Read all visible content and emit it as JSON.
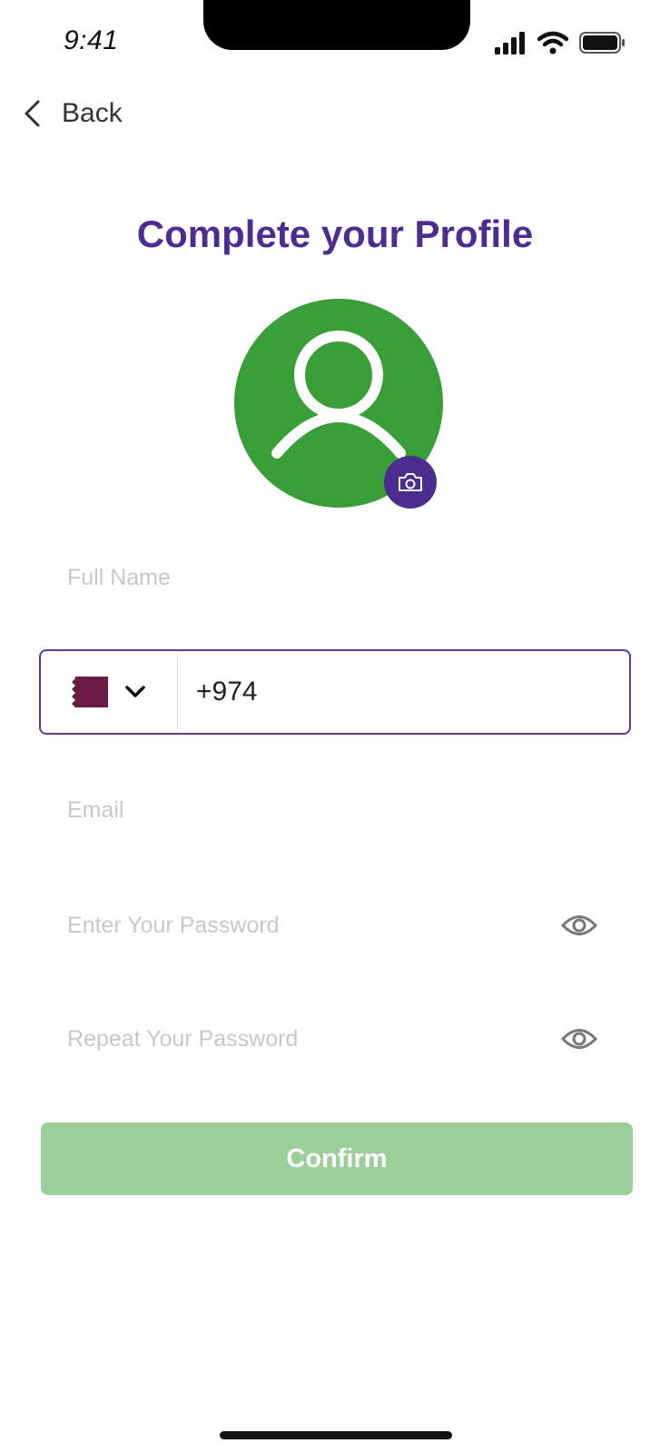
{
  "status_bar": {
    "time": "9:41"
  },
  "nav": {
    "back_label": "Back"
  },
  "page": {
    "title": "Complete your Profile"
  },
  "colors": {
    "accent": "#4c2c8f",
    "avatar_bg": "#399d38",
    "confirm_bg": "#9bce99"
  },
  "form": {
    "full_name_placeholder": "Full Name",
    "phone_value": "+974",
    "email_placeholder": "Email",
    "password_placeholder": "Enter Your Password",
    "repeat_password_placeholder": "Repeat Your Password"
  },
  "actions": {
    "confirm_label": "Confirm"
  },
  "icons": [
    "chevron-left-icon",
    "user-icon",
    "camera-icon",
    "qatar-flag-icon",
    "chevron-down-icon",
    "eye-icon",
    "signal-icon",
    "wifi-icon",
    "battery-icon"
  ]
}
